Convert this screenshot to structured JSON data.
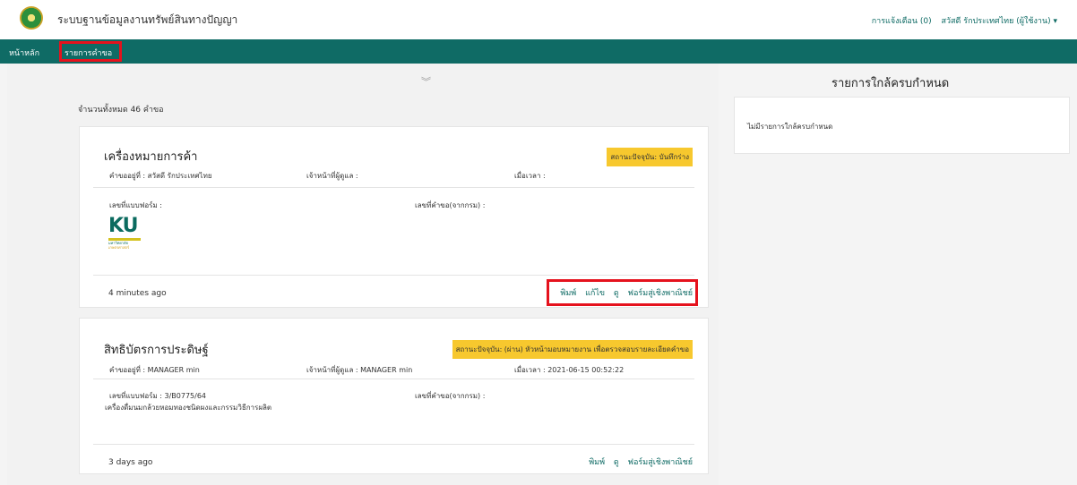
{
  "header": {
    "title": "ระบบฐานข้อมูลงานทรัพย์สินทางปัญญา",
    "notifications": "การแจ้งเตือน (0)",
    "user": "สวัสดี รักประเทศไทย (ผู้ใช้งาน) ▾"
  },
  "nav": {
    "home": "หน้าหลัก",
    "requests": "รายการคำขอ"
  },
  "main": {
    "total": "จำนวนทั้งหมด 46 คำขอ",
    "cards": [
      {
        "title": "เครื่องหมายการค้า",
        "status": "สถานะปัจจุบัน: บันทึกร่าง",
        "requester": "คำขออยู่ที่ : สวัสดี รักประเทศไทย",
        "officer": "เจ้าหน้าที่ผู้ดูแล :",
        "datetime": "เมื่อเวลา :",
        "form_no": "เลขที่แบบฟอร์ม :",
        "request_no": "เลขที่คำขอ(จากกรม) :",
        "logo": {
          "text": "KU",
          "sub1": "มหาวิทยาลัย",
          "sub2": "เกษตรศาสตร์"
        },
        "time_ago": "4 minutes ago",
        "actions": [
          "พิมพ์",
          "แก้ไข",
          "ดู",
          "ฟอร์มสู่เชิงพาณิชย์"
        ]
      },
      {
        "title": "สิทธิบัตรการประดิษฐ์",
        "status": "สถานะปัจจุบัน: (ผ่าน) หัวหน้ามอบหมายงาน เพื่อตรวจสอบรายละเอียดคำขอ",
        "requester": "คำขออยู่ที่ : MANAGER min",
        "officer": "เจ้าหน้าที่ผู้ดูแล : MANAGER min",
        "datetime": "เมื่อเวลา : 2021-06-15 00:52:22",
        "form_no": "เลขที่แบบฟอร์ม : 3/B0775/64",
        "request_no": "เลขที่คำขอ(จากกรม) :",
        "description": "เครื่องดื่มนมกล้วยหอมทองชนิดผงและกรรมวิธีการผลิต",
        "time_ago": "3 days ago",
        "actions": [
          "พิมพ์",
          "ดู",
          "ฟอร์มสู่เชิงพาณิชย์"
        ]
      }
    ]
  },
  "sidebar": {
    "title": "รายการใกล้ครบกำหนด",
    "empty": "ไม่มีรายการใกล้ครบกำหนด"
  },
  "colors": {
    "brand": "#0f6b65",
    "status_badge": "#f7c82e",
    "highlight": "#e5121d"
  },
  "icons": {
    "logo": "university-seal-icon",
    "collapse": "double-chevron-down-icon"
  }
}
